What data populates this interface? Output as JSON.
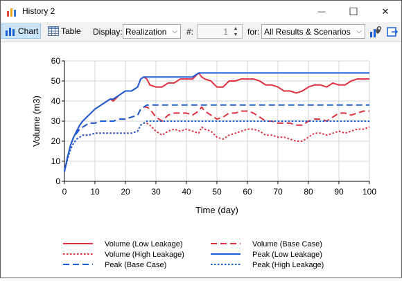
{
  "window": {
    "title": "History 2",
    "minimize_glyph": "—",
    "maximize_glyph": "☐",
    "close_glyph": "✕"
  },
  "toolbar": {
    "chart_label": "Chart",
    "table_label": "Table",
    "display_label": "Display:",
    "display_value": "Realization",
    "number_label": "#:",
    "number_value": "1",
    "for_label": "for:",
    "for_value": "All Results & Scenarios"
  },
  "colors": {
    "red": "#e03040",
    "blue": "#1a5fd6",
    "accent": "#cce4f7"
  },
  "chart_data": {
    "type": "line",
    "xlabel": "Time (day)",
    "ylabel": "Volume (m3)",
    "xlim": [
      0,
      100
    ],
    "ylim": [
      0,
      60
    ],
    "xticks": [
      "0",
      "10",
      "20",
      "30",
      "40",
      "50",
      "60",
      "70",
      "80",
      "90",
      "100"
    ],
    "yticks": [
      "0",
      "10",
      "20",
      "30",
      "40",
      "50",
      "60"
    ],
    "grid": true,
    "legend_position": "bottom",
    "series": [
      {
        "name": "Volume (Low Leakage)",
        "color": "#e03040",
        "dash": "solid",
        "x": [
          0,
          1,
          2,
          3,
          4,
          5,
          6,
          8,
          10,
          12,
          14,
          15,
          16,
          18,
          20,
          22,
          24,
          25,
          26,
          27,
          28,
          30,
          32,
          34,
          36,
          38,
          40,
          42,
          44,
          45,
          46,
          48,
          50,
          52,
          54,
          56,
          58,
          60,
          62,
          64,
          66,
          68,
          70,
          72,
          74,
          76,
          78,
          80,
          82,
          84,
          86,
          88,
          90,
          92,
          94,
          96,
          98,
          100
        ],
        "y": [
          5,
          12,
          18,
          22,
          25,
          28,
          30,
          33,
          36,
          38,
          40,
          41,
          40,
          43,
          45,
          45,
          47,
          51,
          52,
          51,
          48,
          47,
          47,
          49,
          49,
          51,
          51,
          51,
          54,
          52,
          51,
          50,
          47,
          47,
          50,
          50,
          51,
          51,
          51,
          50,
          48,
          48,
          47,
          45,
          45,
          44,
          45,
          47,
          48,
          48,
          47,
          49,
          48,
          48,
          50,
          51,
          51,
          51
        ]
      },
      {
        "name": "Volume (Base Case)",
        "color": "#e03040",
        "dash": "dash",
        "x": [
          0,
          1,
          2,
          3,
          4,
          5,
          6,
          8,
          10,
          12,
          14,
          16,
          18,
          20,
          22,
          24,
          25,
          26,
          27,
          28,
          30,
          32,
          34,
          36,
          38,
          40,
          42,
          44,
          45,
          46,
          48,
          50,
          52,
          54,
          56,
          58,
          60,
          62,
          64,
          66,
          68,
          70,
          72,
          74,
          76,
          78,
          80,
          82,
          84,
          86,
          88,
          90,
          92,
          94,
          96,
          98,
          100
        ],
        "y": [
          5,
          12,
          18,
          22,
          24,
          26,
          27,
          29,
          29,
          30,
          30,
          30,
          31,
          31,
          32,
          33,
          36,
          37,
          37,
          36,
          32,
          30,
          33,
          34,
          34,
          34,
          33,
          35,
          37,
          35,
          33,
          31,
          32,
          34,
          34,
          35,
          35,
          34,
          32,
          30,
          30,
          29,
          29,
          29,
          28,
          28,
          30,
          31,
          31,
          30,
          32,
          34,
          34,
          33,
          34,
          35,
          35
        ]
      },
      {
        "name": "Volume (High Leakage)",
        "color": "#e03040",
        "dash": "dot",
        "x": [
          0,
          1,
          2,
          3,
          4,
          5,
          6,
          8,
          10,
          12,
          14,
          16,
          18,
          20,
          22,
          24,
          25,
          26,
          27,
          28,
          30,
          32,
          34,
          36,
          38,
          40,
          42,
          44,
          45,
          46,
          48,
          50,
          52,
          54,
          56,
          58,
          60,
          62,
          64,
          66,
          68,
          70,
          72,
          74,
          76,
          78,
          80,
          82,
          84,
          86,
          88,
          90,
          92,
          94,
          96,
          98,
          100
        ],
        "y": [
          5,
          11,
          16,
          19,
          21,
          22,
          23,
          23,
          24,
          24,
          24,
          24,
          24,
          24,
          24,
          25,
          28,
          29,
          29,
          28,
          25,
          23,
          25,
          26,
          25,
          26,
          25,
          24,
          27,
          26,
          25,
          22,
          21,
          23,
          24,
          25,
          26,
          26,
          25,
          23,
          23,
          22,
          22,
          21,
          20,
          20,
          22,
          24,
          24,
          23,
          24,
          25,
          24,
          25,
          26,
          26,
          27
        ]
      },
      {
        "name": "Peak (Low Leakage)",
        "color": "#1a5fd6",
        "dash": "solid",
        "x": [
          0,
          1,
          2,
          3,
          4,
          5,
          6,
          8,
          10,
          12,
          14,
          15,
          16,
          18,
          20,
          22,
          24,
          25,
          26,
          27,
          28,
          30,
          32,
          34,
          36,
          38,
          40,
          42,
          44,
          45,
          46,
          100
        ],
        "y": [
          5,
          12,
          18,
          22,
          25,
          28,
          30,
          33,
          36,
          38,
          40,
          41,
          41,
          43,
          45,
          45,
          47,
          51,
          52,
          52,
          52,
          52,
          52,
          52,
          52,
          52,
          52,
          52,
          54,
          54,
          54,
          54
        ]
      },
      {
        "name": "Peak (Base Case)",
        "color": "#1a5fd6",
        "dash": "dash",
        "x": [
          0,
          1,
          2,
          3,
          4,
          5,
          6,
          8,
          10,
          12,
          14,
          16,
          18,
          20,
          22,
          24,
          25,
          26,
          27,
          100
        ],
        "y": [
          5,
          12,
          18,
          22,
          24,
          26,
          27,
          29,
          29,
          30,
          30,
          30,
          31,
          31,
          32,
          33,
          36,
          37,
          38,
          38
        ]
      },
      {
        "name": "Peak (High Leakage)",
        "color": "#1a5fd6",
        "dash": "dot",
        "x": [
          0,
          1,
          2,
          3,
          4,
          5,
          6,
          8,
          10,
          12,
          14,
          16,
          18,
          20,
          22,
          24,
          25,
          26,
          27,
          100
        ],
        "y": [
          5,
          11,
          16,
          19,
          21,
          22,
          23,
          23,
          24,
          24,
          24,
          24,
          24,
          24,
          24,
          25,
          28,
          29,
          30,
          30
        ]
      }
    ],
    "legend_order": [
      0,
      1,
      2,
      3,
      4,
      5
    ]
  }
}
